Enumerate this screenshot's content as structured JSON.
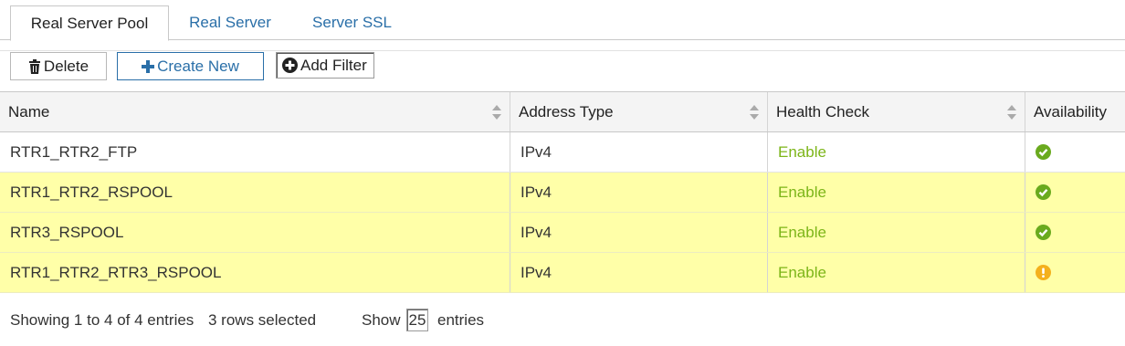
{
  "tabs": [
    {
      "label": "Real Server Pool",
      "active": true
    },
    {
      "label": "Real Server",
      "active": false
    },
    {
      "label": "Server SSL",
      "active": false
    }
  ],
  "toolbar": {
    "delete_label": "Delete",
    "delete_icon": "trash-icon",
    "create_label": "Create New",
    "create_icon": "plus-icon",
    "filter_label": "Add Filter",
    "filter_icon": "plus-circle-icon"
  },
  "table": {
    "columns": [
      "Name",
      "Address Type",
      "Health Check",
      "Availability"
    ],
    "rows": [
      {
        "name": "RTR1_RTR2_FTP",
        "address_type": "IPv4",
        "health_check": "Enable",
        "availability": "available",
        "selected": false
      },
      {
        "name": "RTR1_RTR2_RSPOOL",
        "address_type": "IPv4",
        "health_check": "Enable",
        "availability": "available",
        "selected": true
      },
      {
        "name": "RTR3_RSPOOL",
        "address_type": "IPv4",
        "health_check": "Enable",
        "availability": "available",
        "selected": true
      },
      {
        "name": "RTR1_RTR2_RTR3_RSPOOL",
        "address_type": "IPv4",
        "health_check": "Enable",
        "availability": "warning",
        "selected": true
      }
    ]
  },
  "footer": {
    "showing": "Showing 1 to 4 of 4 entries",
    "selected": "3 rows selected",
    "show_label": "Show",
    "page_size": "25",
    "entries_label": "entries"
  },
  "colors": {
    "accent": "#2a6fa8",
    "enable": "#7cb518",
    "ok": "#6aaa1e",
    "warning": "#f4b01c",
    "selected_row": "#ffffa8"
  }
}
